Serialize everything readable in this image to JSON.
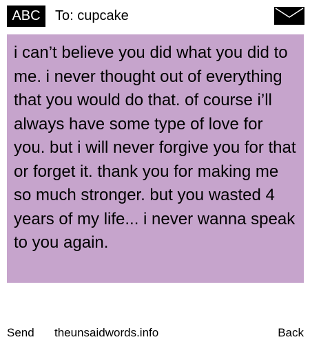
{
  "header": {
    "input_mode": "ABC",
    "recipient_line": "To: cupcake",
    "icon": "envelope-icon"
  },
  "message": {
    "text": "i can’t believe you did what you did to me. i never thought out of everything that you would do that. of course i’ll always have some type of love for you. but i will never forgive you for that or forget it. thank you for making me so much stronger. but you wasted 4 years of my life... i never wanna speak to you again."
  },
  "footer": {
    "send_label": "Send",
    "site_label": "theunsaidwords.info",
    "back_label": "Back"
  },
  "colors": {
    "message_background": "#c6a4cc",
    "badge_background": "#000000",
    "badge_text": "#ffffff"
  }
}
